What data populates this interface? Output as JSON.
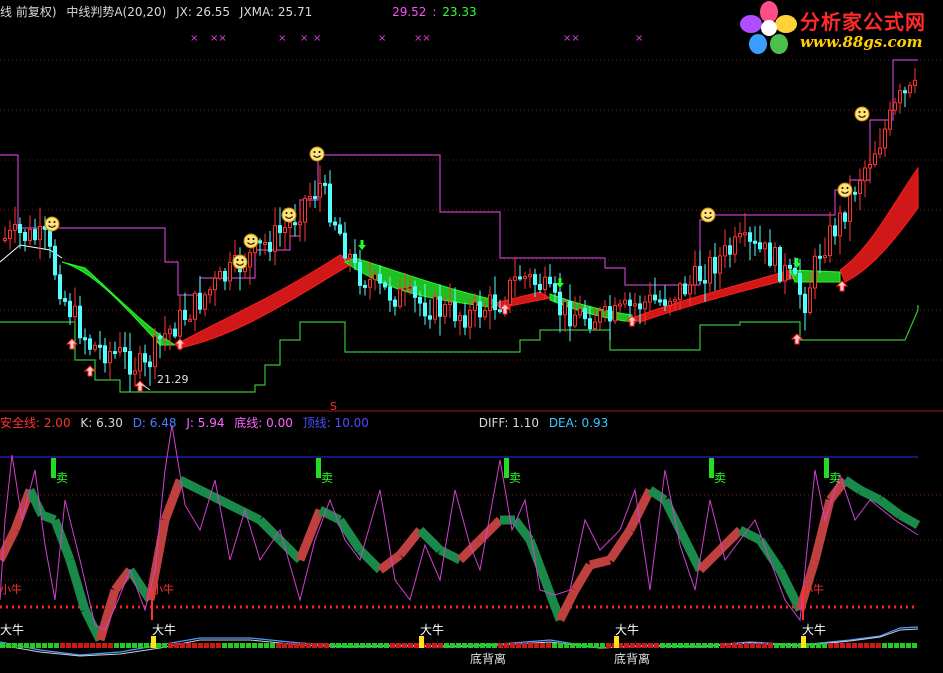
{
  "header": {
    "prefix": "线 前复权)",
    "indicator": "中线判势A(20,20)",
    "jx_label": "JX: 26.55",
    "jxma_label": "JXMA: 25.71",
    "val_a": "29.52",
    "sep": ":",
    "val_b": "23.33",
    "colors": {
      "prefix": "#d9d9d9",
      "indicator": "#d9d9d9",
      "jx": "#d9d9d9",
      "jxma": "#d9d9d9",
      "val_a": "#ff4dff",
      "val_b": "#33ff33"
    }
  },
  "lower_header": {
    "safe_line": "安全线: 2.00",
    "k": "K: 6.30",
    "d": "D: 6.48",
    "j": "J: 5.94",
    "bottom_line": "底线: 0.00",
    "top_line": "顶线: 10.00",
    "diff": "DIFF: 1.10",
    "dea": "DEA: 0.93",
    "colors": {
      "safe": "#ff3333",
      "k": "#d9d9d9",
      "d": "#4d7dff",
      "j": "#ff66ff",
      "bottom": "#ff66ff",
      "top": "#4d4dff",
      "diff": "#d9d9d9",
      "dea": "#33ccff"
    }
  },
  "logo": {
    "title": "分析家公式网",
    "url": "www.88gs.com"
  },
  "chart_data": {
    "type": "candlestick",
    "annotations": {
      "low_price_label": "21.29",
      "s_marker": "S",
      "sell_label": "卖",
      "bull_label": "大牛",
      "bull_small_label": "小牛",
      "divergence_label": "底背离",
      "top_marks": "×"
    },
    "colors": {
      "up": "#ff3232",
      "down": "#54ffff",
      "band_up": "#ff1e1e",
      "band_down": "#22ff22",
      "upper_channel": "#c040c0",
      "lower_channel": "#38c038",
      "kdj_k": "#d040d0",
      "ribbon_up": "#c04040",
      "ribbon_down": "#1a8a4a",
      "safe_dots": "#ff2020",
      "macd_line": "#4d9dff"
    }
  }
}
